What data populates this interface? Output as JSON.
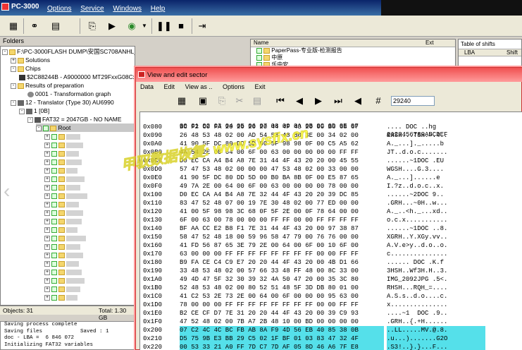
{
  "app": {
    "title": "PC-3000"
  },
  "menu": [
    "Options",
    "Service",
    "Windows",
    "Help"
  ],
  "folders": {
    "label": "Folders",
    "root_path": "F:\\PC-3000FLASH DUMP\\安国SC708ANHL_8G",
    "items": [
      {
        "label": "Solutions",
        "expander": "+"
      },
      {
        "label": "Chips",
        "expander": "-"
      },
      {
        "label": "$2C88244B - A9000000 MT29FxxG08Cxx",
        "expander": ""
      },
      {
        "label": "Results of preparation",
        "expander": "-"
      },
      {
        "label": "0001 - Transformation graph",
        "expander": ""
      },
      {
        "label": "12 - Translator (Type 30) AU6990",
        "expander": "-"
      },
      {
        "label": "1 [0B]",
        "expander": "-"
      },
      {
        "label": "FAT32 = 2047GB - NO NAME",
        "expander": "-"
      },
      {
        "label": "Root",
        "expander": "-"
      }
    ]
  },
  "files_panel": {
    "col_name": "Name",
    "col_ext": "Ext",
    "rows": [
      "PaperPass-专业版-检测报告",
      "中原",
      "乐中安"
    ]
  },
  "shifts_panel": {
    "title": "Table of shifts",
    "col_lba": "LBA",
    "col_shift": "Shift"
  },
  "status": {
    "objects": "Objects: 31",
    "total": "Total: 1.30 GB"
  },
  "log": [
    "Saving process complete",
    "Saving files            Saved : 1",
    "doc - LBA =  6 846 072",
    "Initializing FAT32 variables"
  ],
  "hex_window": {
    "title": "View and edit sector",
    "menu": [
      "Data",
      "Edit",
      "View as ..",
      "Options",
      "Exit"
    ],
    "offset_value": "29240",
    "header_bytes": "00 01 02 03 04 05 06 07 08 09 0A 0B 0C 0D 0E 0F",
    "header_ascii": "0123456789ABCDEF",
    "rows": [
      {
        "off": "0x080",
        "bytes": "BC F2 C0 FA 20 20 20 20 44 4F 43 20 00 B6 68 67",
        "asc": ".... DOC ..hg"
      },
      {
        "off": "0x090",
        "bytes": "26 48 53 48 02 00 AD 54 53 48 B0 3E 00 34 02 00",
        "asc": "&HSH...TSH.>.4.."
      },
      {
        "off": "0x0A0",
        "bytes": "41 90 5F DC 80 DD 5D 00 5F 98 98 0F 00 C5 A5 62",
        "asc": "A._...]._.....b"
      },
      {
        "off": "0x0B0",
        "bytes": "4A 54 2E 00 64 00 6F 00 63 00 00 00 00 00 FF FF",
        "asc": "JT..d.o.c......."
      },
      {
        "off": "0x0C0",
        "bytes": "D0 EC CA A4 B4 A8 7E 31 44 4F 43 20 20 00 45 55",
        "asc": "......~1DOC .EU"
      },
      {
        "off": "0x0D0",
        "bytes": "57 47 53 48 02 00 00 00 47 53 48 02 00 33 00 00",
        "asc": "WGSH....G.3...."
      },
      {
        "off": "0x0E0",
        "bytes": "41 90 5F DC 80 DD 5D 00 B0 BA 8B 0F 00 E5 87 65",
        "asc": "A._...]......e"
      },
      {
        "off": "0x0F0",
        "bytes": "49 7A 2E 00 64 00 6F 00 63 00 00 00 00 78 00 00",
        "asc": "I.?z..d.o.c..x."
      },
      {
        "off": "0x100",
        "bytes": "D0 EC CA A4 B4 A8 7E 32 44 4F 43 20 20 39 DC 85",
        "asc": "......~2DOC 9.."
      },
      {
        "off": "0x110",
        "bytes": "83 47 52 48 07 00 19 7E 30 48 02 00 77 ED 00 00",
        "asc": ".GRH...~0H..w..."
      },
      {
        "off": "0x120",
        "bytes": "41 00 5F 98 98 3C 68 0F 5F 2E 00 0F 78 64 00 00",
        "asc": "A._..<h._...xd.."
      },
      {
        "off": "0x130",
        "bytes": "6F 00 63 00 78 00 00 00 FF FF 00 00 FF FF FF FF",
        "asc": "o.c.x..........."
      },
      {
        "off": "0x140",
        "bytes": "BF AA CC E2 B8 F1 7E 31 44 4F 43 20 00 97 38 87",
        "asc": "......~1DOC ..8."
      },
      {
        "off": "0x150",
        "bytes": "58 47 52 48 18 00 59 96 58 47 79 00 76 76 00 00",
        "asc": "XGRH..Y.XGy.vv.."
      },
      {
        "off": "0x160",
        "bytes": "41 FD 56 87 65 3E 79 2E 00 64 00 6F 00 10 6F 00",
        "asc": "A.V.e>y..d.o..o."
      },
      {
        "off": "0x170",
        "bytes": "63 00 00 00 FF FF FF FF FF FF FF FF 00 00 FF FF",
        "asc": "c..............."
      },
      {
        "off": "0x180",
        "bytes": "B9 FA CE C4 C9 E7 20 20 44 4F 43 20 00 4B D1 66",
        "asc": "...... DOC .K.f"
      },
      {
        "off": "0x190",
        "bytes": "33 48 53 48 02 00 57 66 33 48 FF 48 00 8C 33 00",
        "asc": "3HSH..Wf3H.H..3."
      },
      {
        "off": "0x1A0",
        "bytes": "49 4D 47 5F 32 30 39 32 4A 50 47 20 00 35 3C 80",
        "asc": "IMG_2092JPG .5<."
      },
      {
        "off": "0x1B0",
        "bytes": "52 48 53 48 02 00 80 52 51 48 5F 3D DB 80 01 00",
        "asc": "RHSH...RQH_=...."
      },
      {
        "off": "0x1C0",
        "bytes": "41 C2 53 2E 73 2E 00 64 00 6F 00 00 00 95 63 00",
        "asc": "A.S.s..d.o....c."
      },
      {
        "off": "0x1D0",
        "bytes": "78 00 00 00 FF FF FF FF FF FF FF FF 00 00 FF FF",
        "asc": "x..............."
      },
      {
        "off": "0x1E0",
        "bytes": "B2 CE CF D7 7E 31 20 20 44 4F 43 20 00 39 C9 93",
        "asc": "....~1  DOC .9.."
      },
      {
        "off": "0x1F0",
        "bytes": "47 52 48 02 00 7B A7 2B 48 10 00 BD 00 00 00 00",
        "asc": ".GRH..{.+H......"
      },
      {
        "off": "0x200",
        "bytes": "07 C2 4C 4C BC FB AB 8A F9 4D 56 EB 40 85 38 0B",
        "asc": "..LL.....MV.@.8."
      },
      {
        "off": "0x210",
        "bytes": "D5 75 9B E3 BB 29 C5 02 1F BF 01 03 83 47 32 4F",
        "asc": ".u...).......G2O"
      },
      {
        "off": "0x220",
        "bytes": "00 53 33 21 A0 FF 7D C7 7D AF 05 8D 46 A6 7F E8",
        "asc": ".S3!..}.}...F..."
      }
    ]
  },
  "watermark": "甲驭数据恢复: www.sysfix.cn",
  "colors": {
    "hex_title": "#f05050",
    "selection": "#55e0ea",
    "menu_bg": "#ece9d8"
  }
}
